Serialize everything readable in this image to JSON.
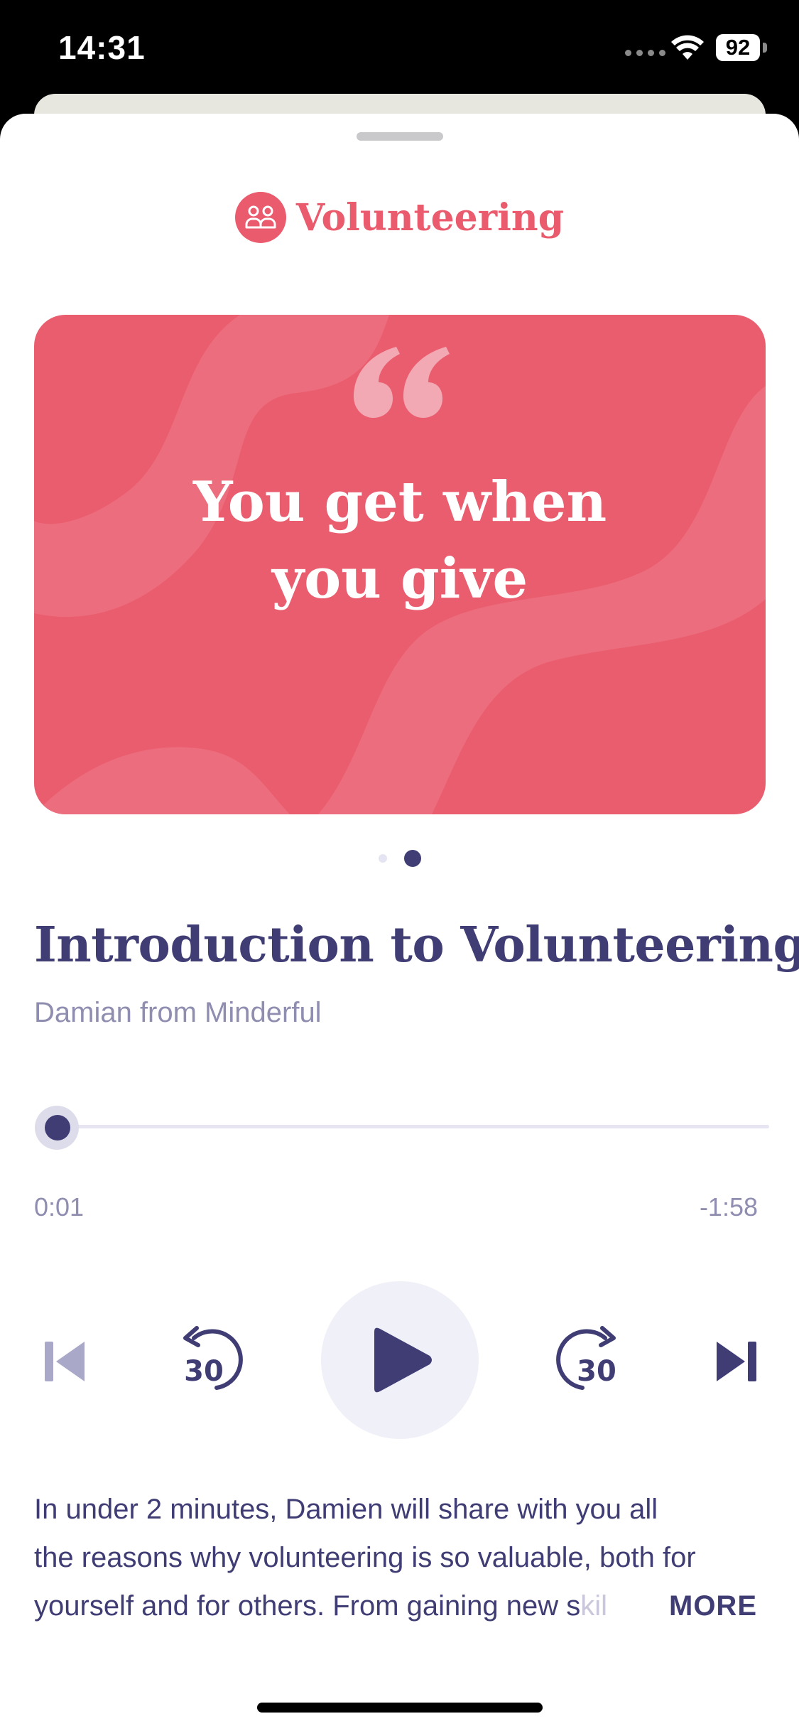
{
  "status_bar": {
    "time": "14:31",
    "battery": "92"
  },
  "category": {
    "label": "Volunteering",
    "icon": "people-icon",
    "color": "#e95b6d"
  },
  "card": {
    "quote": "You get when you give",
    "background": "#ea5d6f",
    "active_page": 2,
    "page_count": 2
  },
  "track": {
    "title": "Introduction to Volunteering",
    "author": "Damian from Minderful"
  },
  "player": {
    "elapsed": "0:01",
    "remaining": "-1:58",
    "progress": 0.01,
    "skip_back_seconds": "30",
    "skip_forward_seconds": "30",
    "accent": "#3f3d74"
  },
  "description": {
    "line1": "In under 2 minutes, Damien will share with you all",
    "line2": "the reasons why volunteering is so valuable, both for",
    "line3": "yourself and for others. From gaining new s",
    "line3_fade": "kil",
    "more_label": "MORE"
  }
}
